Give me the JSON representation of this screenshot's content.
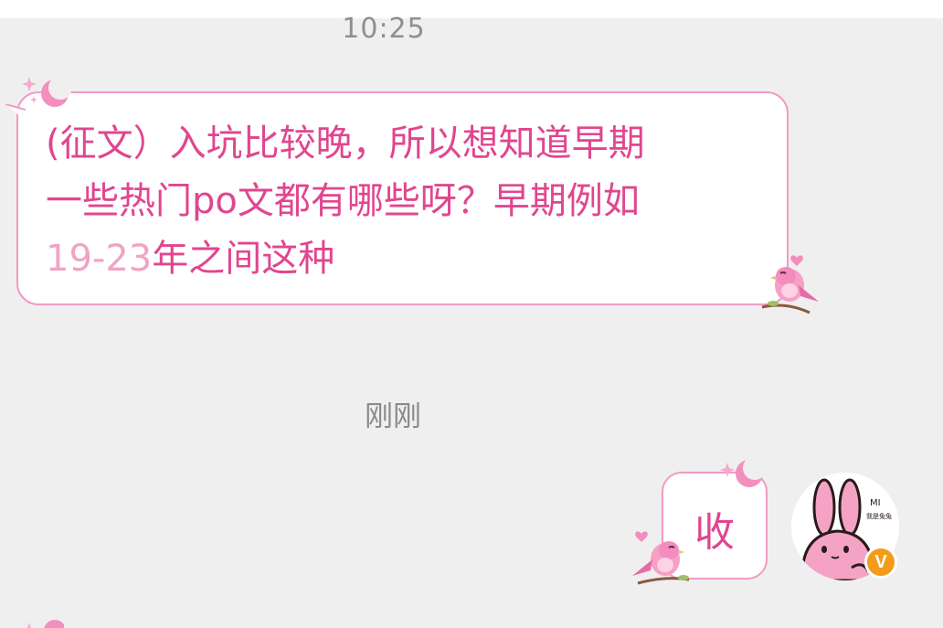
{
  "chat": {
    "timestamps": [
      "10:25",
      "刚刚"
    ],
    "incoming": {
      "line1": "(征文）入坑比较晚，所以想知道早期",
      "line2": "一些热门po文都有哪些呀？早期例如",
      "line3_number": "19-23",
      "line3_rest": "年之间这种"
    },
    "outgoing": {
      "text": "收"
    },
    "avatar": {
      "sticker_text_top": "MI",
      "sticker_text_bottom": "我是兔兔",
      "badge": "V"
    }
  },
  "colors": {
    "text_pink": "#e0468f",
    "number_pink": "#f0a4c4",
    "bubble_border": "#f29ac4",
    "bird_pink": "#f07ab0",
    "badge_orange": "#f39b1a",
    "background": "#efefef"
  },
  "icons": [
    "moon-sparkle-icon",
    "pink-bird-icon",
    "heart-icon",
    "bunny-avatar-icon",
    "verified-badge-icon"
  ]
}
